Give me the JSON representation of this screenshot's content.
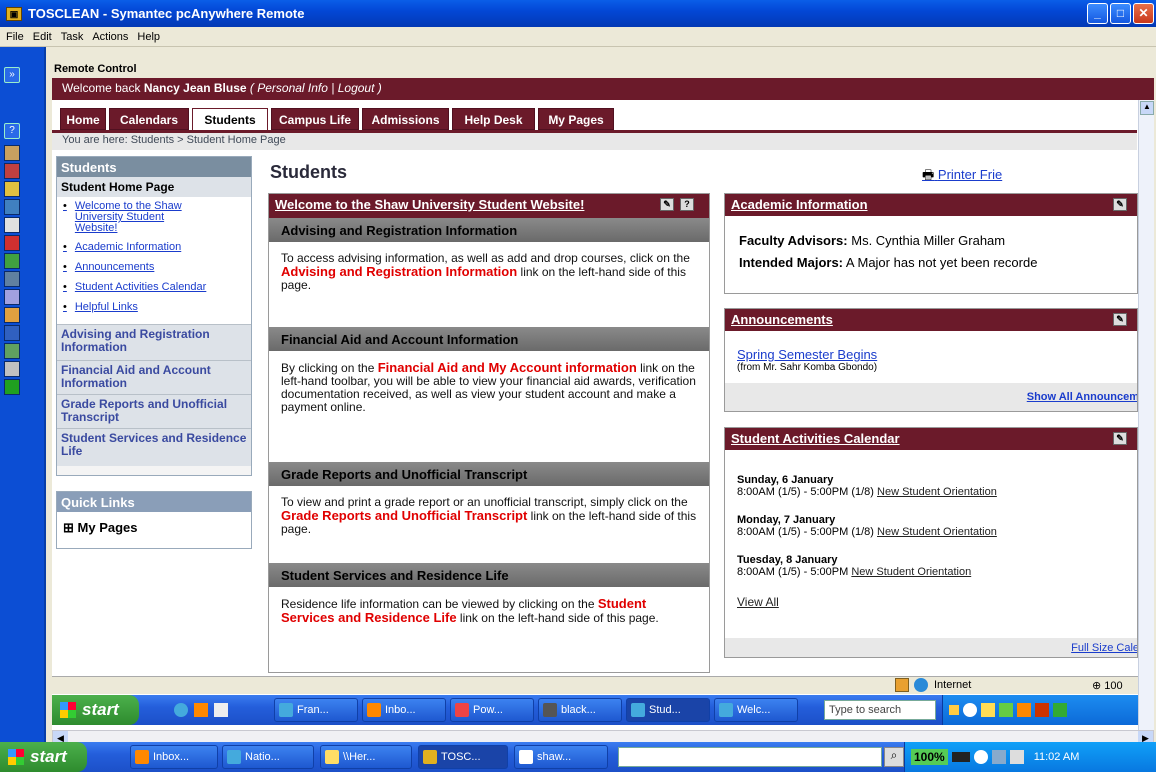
{
  "window": {
    "title": "TOSCLEAN - Symantec pcAnywhere Remote",
    "app_icon": "pcanywhere-icon",
    "menu": [
      "File",
      "Edit",
      "Task",
      "Actions",
      "Help"
    ]
  },
  "remote_label": "Remote Control",
  "site": {
    "welcome_prefix": "Welcome back",
    "user_name": "Nancy Jean Bluse",
    "welcome_links": "( Personal Info | Logout )",
    "nav_tabs": [
      "Home",
      "Calendars",
      "Students",
      "Campus Life",
      "Admissions",
      "Help Desk",
      "My Pages"
    ],
    "active_tab": "Students",
    "breadcrumb": "You are here:  Students > Student Home Page",
    "left_nav": {
      "header": "Students",
      "subheader": "Student Home Page",
      "links": [
        "Welcome to the Shaw University Student Website!",
        "Academic Information",
        "Announcements",
        "Student Activities Calendar",
        "Helpful Links"
      ],
      "sections": [
        "Advising and Registration Information",
        "Financial Aid and Account Information",
        "Grade Reports and Unofficial Transcript",
        "Student Services and Residence Life"
      ]
    },
    "quick_links": {
      "header": "Quick Links",
      "item": "My Pages",
      "expander": "⊞"
    },
    "page_title": "Students",
    "printer_link": "Printer Frie",
    "welcome_panel": {
      "title": "Welcome to the Shaw University Student Website!",
      "sections": [
        {
          "heading": "Advising and Registration Information",
          "text_before": "To access advising information, as well as add and drop courses, click on the ",
          "highlight": "Advising and Registration Information",
          "text_after": " link on the left-hand side of this page."
        },
        {
          "heading": "Financial Aid and Account Information",
          "text_before": "By clicking on the ",
          "highlight": "Financial Aid and My Account information",
          "text_after": " link on the left-hand toolbar, you will be able to view your financial aid awards, verification documentation received, as well as view your student account and make a payment online."
        },
        {
          "heading": "Grade Reports and Unofficial Transcript",
          "text_before": "To view and print a grade report or an unofficial transcript, simply click on the ",
          "highlight": "Grade Reports and Unofficial Transcript",
          "text_after": " link on the left-hand side of this page."
        },
        {
          "heading": "Student Services and Residence Life",
          "text_before": "Residence life information can be viewed by clicking on the ",
          "highlight": "Student Services and Residence Life",
          "text_after": " link on the left-hand side of this page."
        }
      ]
    },
    "academic_panel": {
      "title": "Academic Information",
      "advisors_label": "Faculty Advisors:",
      "advisors_value": "Ms. Cynthia Miller Graham",
      "majors_label": "Intended Majors:",
      "majors_value": "A Major has not yet been recorde"
    },
    "announcements_panel": {
      "title": "Announcements",
      "item_title": "Spring Semester Begins",
      "item_from": "(from Mr. Sahr Komba Gbondo)",
      "show_all": "Show All Announcem"
    },
    "calendar_panel": {
      "title": "Student Activities Calendar",
      "events": [
        {
          "date": "Sunday, 6 January",
          "time": "8:00AM (1/5) - 5:00PM (1/8)",
          "name": "New Student Orientation"
        },
        {
          "date": "Monday, 7 January",
          "time": "8:00AM (1/5) - 5:00PM (1/8)",
          "name": "New Student Orientation"
        },
        {
          "date": "Tuesday, 8 January",
          "time": "8:00AM (1/5) - 5:00PM",
          "name": "New Student Orientation"
        }
      ],
      "view_all": "View All",
      "full_size": "Full Size Cale"
    }
  },
  "ie_status": {
    "zone": "Internet",
    "zoom": "100"
  },
  "remote_taskbar": {
    "start": "start",
    "buttons": [
      "Fran...",
      "Inbo...",
      "Pow...",
      "black...",
      "Stud...",
      "Welc..."
    ],
    "search_placeholder": "Type to search"
  },
  "local_taskbar": {
    "start": "start",
    "buttons": [
      "Inbox...",
      "Natio...",
      "\\\\Her...",
      "TOSC...",
      "shaw..."
    ],
    "zoom": "100%",
    "clock": "11:02 AM"
  },
  "colors": {
    "maroon": "#6b1a2a",
    "xp_blue": "#245edb",
    "link": "#1a3ccc",
    "highlight": "#e00000"
  }
}
